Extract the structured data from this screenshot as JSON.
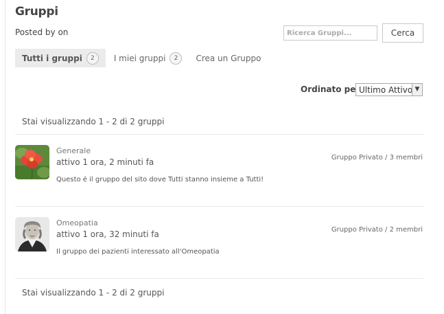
{
  "page": {
    "title": "Gruppi",
    "posted_by": "Posted by on"
  },
  "search": {
    "placeholder": "Ricerca Gruppi...",
    "button": "Cerca"
  },
  "tabs": [
    {
      "label": "Tutti i gruppi",
      "count": "2",
      "active": true
    },
    {
      "label": "I miei gruppi",
      "count": "2",
      "active": false
    },
    {
      "label": "Crea un Gruppo",
      "active": false
    }
  ],
  "order": {
    "label": "Ordinato per:",
    "selected": "Ultimo Attivo"
  },
  "pagination": {
    "text": "Stai visualizzando 1 - 2 di 2 gruppi"
  },
  "groups": [
    {
      "name": "Generale",
      "active": "attivo 1 ora, 2 minuti fa",
      "description": "Questo é il gruppo del sito dove Tutti stanno insieme a Tutti!",
      "meta": "Gruppo Privato / 3 membri",
      "avatar_icon": "red-flower-icon"
    },
    {
      "name": "Omeopatia",
      "active": "attivo 1 ora, 32 minuti fa",
      "description": "Il gruppo dei pazienti interessato all'Omeopatia",
      "meta": "Gruppo Privato / 2 membri",
      "avatar_icon": "portrait-icon"
    }
  ]
}
